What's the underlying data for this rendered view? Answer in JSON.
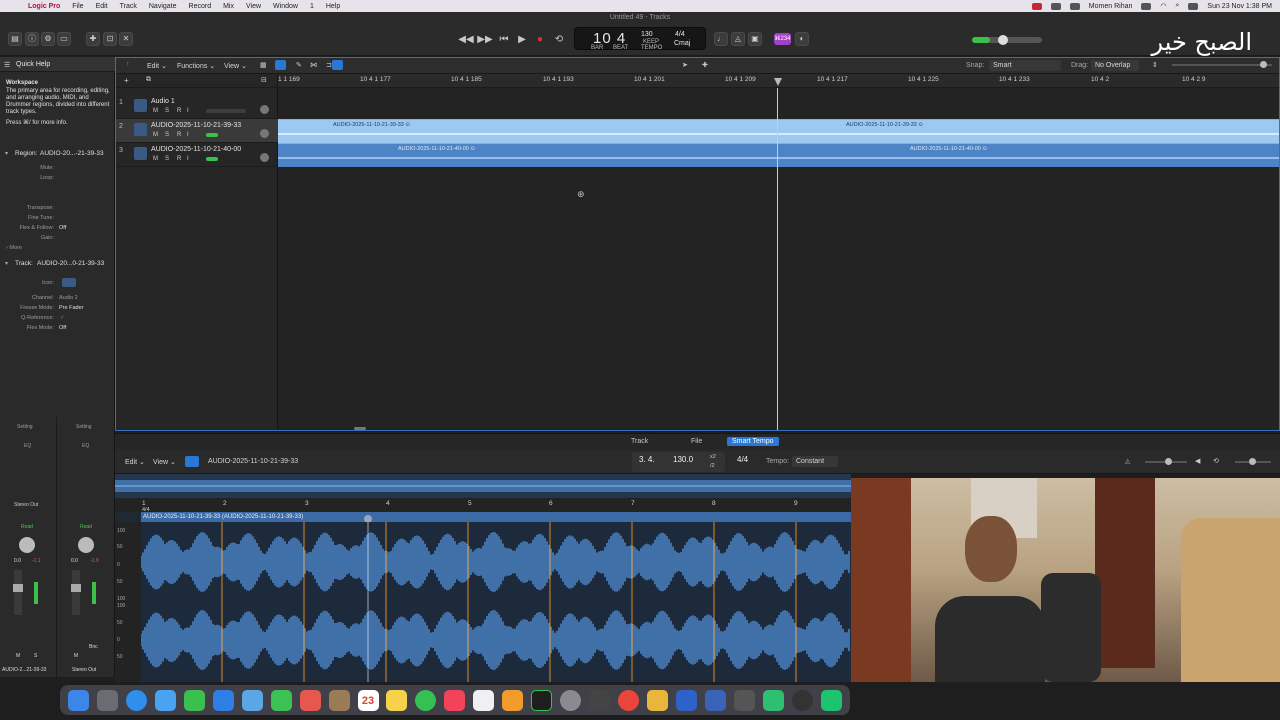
{
  "menubar": {
    "app_name": "Logic Pro",
    "items": [
      "File",
      "Edit",
      "Track",
      "Navigate",
      "Record",
      "Mix",
      "View",
      "Window",
      "1",
      "Help"
    ],
    "user": "Momen Rihan",
    "datetime": "Sun 23 Nov  1:38 PM"
  },
  "window_title": "Untitled 49 - Tracks",
  "overlay_logo": "الصبح خير",
  "lcd": {
    "position": "10 4",
    "bar_label": "BAR",
    "beat_label": "BEAT",
    "tempo": "130",
    "tempo_label": "KEEP",
    "tempo_sub": "TEMPO",
    "time_sig": "4/4",
    "key": "Cmaj"
  },
  "count_badge": "⌘234",
  "inspector": {
    "title": "Quick Help",
    "workspace_head": "Workspace",
    "workspace_text": "The primary area for recording, editing, and arranging audio, MIDI, and Drummer regions, divided into different track types.",
    "more_info": "Press ⌘/ for more info.",
    "region_label": "Region:",
    "region_name": "AUDIO-20...-21-39-33",
    "region_rows": [
      {
        "label": "Mute:",
        "value": ""
      },
      {
        "label": "Loop:",
        "value": ""
      },
      {
        "label": "Transpose:",
        "value": ""
      },
      {
        "label": "Fine Tune:",
        "value": ""
      },
      {
        "label": "Flex & Follow:",
        "value": "Off"
      },
      {
        "label": "Gain:",
        "value": ""
      }
    ],
    "more_label": "More",
    "track_label": "Track:",
    "track_name": "AUDIO-20...0-21-39-33",
    "track_rows": [
      {
        "label": "Icon:",
        "value": ""
      },
      {
        "label": "Channel:",
        "value": "Audio 2"
      },
      {
        "label": "Freeze Mode:",
        "value": "Pre Fader"
      },
      {
        "label": "Q-Reference:",
        "value": "✓"
      },
      {
        "label": "Flex Mode:",
        "value": "Off"
      }
    ]
  },
  "strips": {
    "setting": "Setting",
    "eq": "EQ",
    "stereo_out": "Stereo Out",
    "read": "Read",
    "left_vol": "0.0",
    "left_peak": "-1.1",
    "right_vol": "0.0",
    "right_peak": "-1.9",
    "m": "M",
    "s": "S",
    "bnc": "Bnc",
    "left_name": "AUDIO-2...21-39-33",
    "right_name": "Stereo Out"
  },
  "tracks_toolbar": {
    "edit": "Edit",
    "functions": "Functions",
    "view": "View",
    "snap_label": "Snap:",
    "snap_value": "Smart",
    "drag_label": "Drag:",
    "drag_value": "No Overlap"
  },
  "ruler_labels": [
    "1 1 169",
    "10 4 1 177",
    "10 4 1 185",
    "10 4 1 193",
    "10 4 1 201",
    "10 4 1 209",
    "10 4 1 217",
    "10 4 1 225",
    "10 4 1 233",
    "10 4 2",
    "10 4 2 9"
  ],
  "tracks": [
    {
      "num": "1",
      "name": "Audio 1"
    },
    {
      "num": "2",
      "name": "AUDIO-2025-11-10-21-39-33"
    },
    {
      "num": "3",
      "name": "AUDIO-2025-11-10-21-40-00"
    }
  ],
  "track_buttons": [
    "M",
    "S",
    "R",
    "I"
  ],
  "regions": {
    "r2a": "AUDIO-2025-11-10-21-39-33 ⊙",
    "r2b": "AUDIO-2025-11-10-21-39-33 ⊙",
    "r3a": "AUDIO-2025-11-10-21-40-00 ⊙",
    "r3b": "AUDIO-2025-11-10-21-40-00 ⊙"
  },
  "editor": {
    "tabs": [
      "Track",
      "File",
      "Smart Tempo"
    ],
    "active_tab": "Smart Tempo",
    "edit": "Edit",
    "view": "View",
    "region_name": "AUDIO-2025-11-10-21-39-33",
    "position": "3. 4.",
    "tempo": "130.0",
    "x2": "x2",
    "div2": "/2",
    "time_sig": "4/4",
    "tempo_label": "Tempo:",
    "tempo_mode": "Constant",
    "region_title": "AUDIO-2025-11-10-21-39-33 (AUDIO-2025-11-10-21-39-33)",
    "meter": "4/4",
    "bars": [
      "1",
      "2",
      "3",
      "4",
      "5",
      "6",
      "7",
      "8",
      "9"
    ],
    "amp_labels": [
      "100",
      "50",
      "0",
      "50",
      "100",
      "100",
      "50",
      "0",
      "50"
    ]
  },
  "dock_date": "23",
  "colors": {
    "accent": "#2a78d6",
    "region": "#4d84c6",
    "region_selected": "#9cc9f1",
    "record": "#d9322c",
    "brand": "#b4123a"
  }
}
